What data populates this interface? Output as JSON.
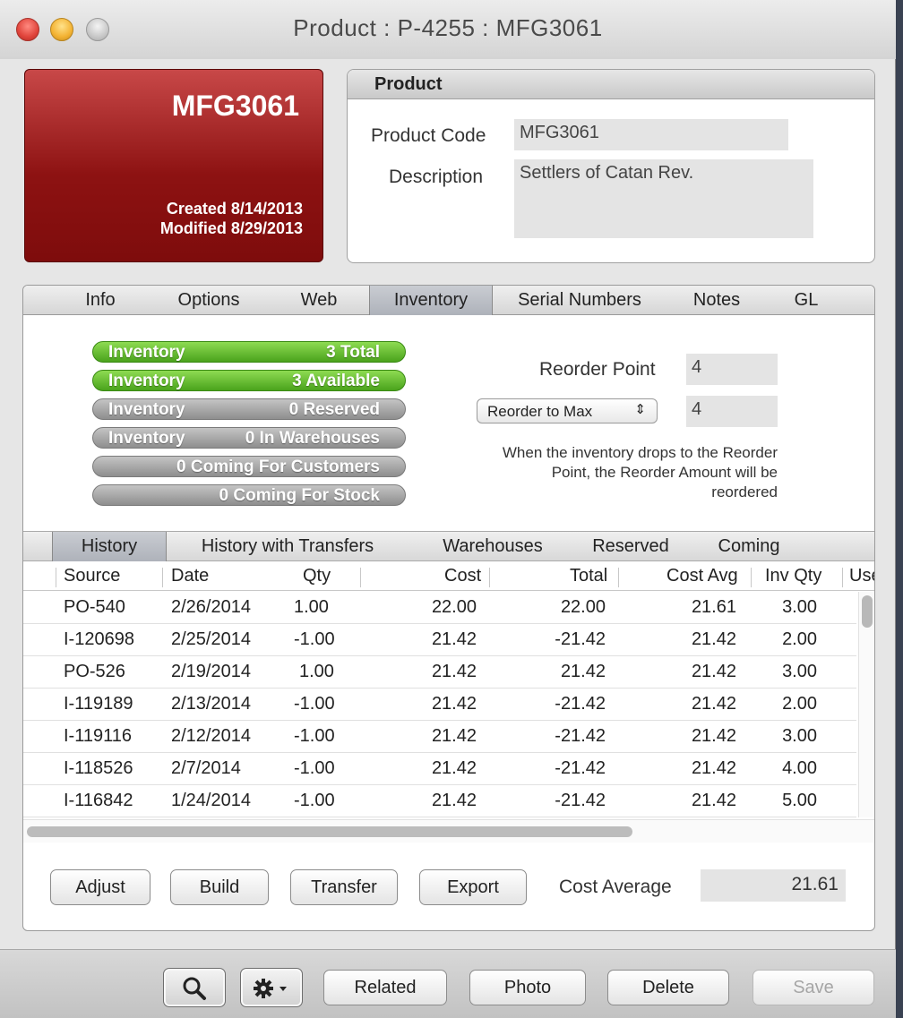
{
  "window": {
    "title": "Product : P-4255 : MFG3061"
  },
  "card": {
    "code": "MFG3061",
    "created": "Created 8/14/2013",
    "modified": "Modified 8/29/2013"
  },
  "product": {
    "header": "Product",
    "code_label": "Product Code",
    "code_value": "MFG3061",
    "desc_label": "Description",
    "desc_value": "Settlers of Catan Rev."
  },
  "tabs": [
    {
      "label": "Info"
    },
    {
      "label": "Options"
    },
    {
      "label": "Web"
    },
    {
      "label": "Inventory",
      "active": true
    },
    {
      "label": "Serial Numbers"
    },
    {
      "label": "Notes"
    },
    {
      "label": "GL"
    }
  ],
  "inventory": {
    "pills": [
      {
        "left": "Inventory",
        "right": "3 Total",
        "color": "green"
      },
      {
        "left": "Inventory",
        "right": "3 Available",
        "color": "green"
      },
      {
        "left": "Inventory",
        "right": "0 Reserved",
        "color": "gray"
      },
      {
        "left": "Inventory",
        "right": "0 In Warehouses",
        "color": "gray"
      },
      {
        "left": "",
        "right": "0 Coming For Customers",
        "color": "gray"
      },
      {
        "left": "",
        "right": "0 Coming For Stock",
        "color": "gray"
      }
    ],
    "reorder_point_label": "Reorder Point",
    "reorder_point_value": "4",
    "reorder_select": "Reorder to Max",
    "reorder_select_arrow": "⇕",
    "reorder_amount_value": "4",
    "note": "When the inventory drops to the Reorder Point, the Reorder Amount will be reordered"
  },
  "subtabs": [
    {
      "label": "History",
      "active": true
    },
    {
      "label": "History with Transfers"
    },
    {
      "label": "Warehouses"
    },
    {
      "label": "Reserved"
    },
    {
      "label": "Coming"
    }
  ],
  "table": {
    "columns": [
      "Source",
      "Date",
      "Qty",
      "Cost",
      "Total",
      "Cost Avg",
      "Inv Qty",
      "Use"
    ],
    "rows": [
      [
        "PO-540",
        "2/26/2014",
        "1.00",
        "22.00",
        "22.00",
        "21.61",
        "3.00"
      ],
      [
        "I-120698",
        "2/25/2014",
        "-1.00",
        "21.42",
        "-21.42",
        "21.42",
        "2.00"
      ],
      [
        "PO-526",
        "2/19/2014",
        "1.00",
        "21.42",
        "21.42",
        "21.42",
        "3.00"
      ],
      [
        "I-119189",
        "2/13/2014",
        "-1.00",
        "21.42",
        "-21.42",
        "21.42",
        "2.00"
      ],
      [
        "I-119116",
        "2/12/2014",
        "-1.00",
        "21.42",
        "-21.42",
        "21.42",
        "3.00"
      ],
      [
        "I-118526",
        "2/7/2014",
        "-1.00",
        "21.42",
        "-21.42",
        "21.42",
        "4.00"
      ],
      [
        "I-116842",
        "1/24/2014",
        "-1.00",
        "21.42",
        "-21.42",
        "21.42",
        "5.00"
      ]
    ]
  },
  "actions": {
    "adjust": "Adjust",
    "build": "Build",
    "transfer": "Transfer",
    "export": "Export",
    "cost_avg_label": "Cost Average",
    "cost_avg_value": "21.61"
  },
  "bottom": {
    "search_icon": "search-icon",
    "gear_icon": "gear-icon",
    "related": "Related",
    "photo": "Photo",
    "delete": "Delete",
    "save": "Save"
  },
  "colors": {
    "card_red": "#8d1212",
    "pill_green": "#4aa31c",
    "pill_gray": "#8e8e8e"
  }
}
